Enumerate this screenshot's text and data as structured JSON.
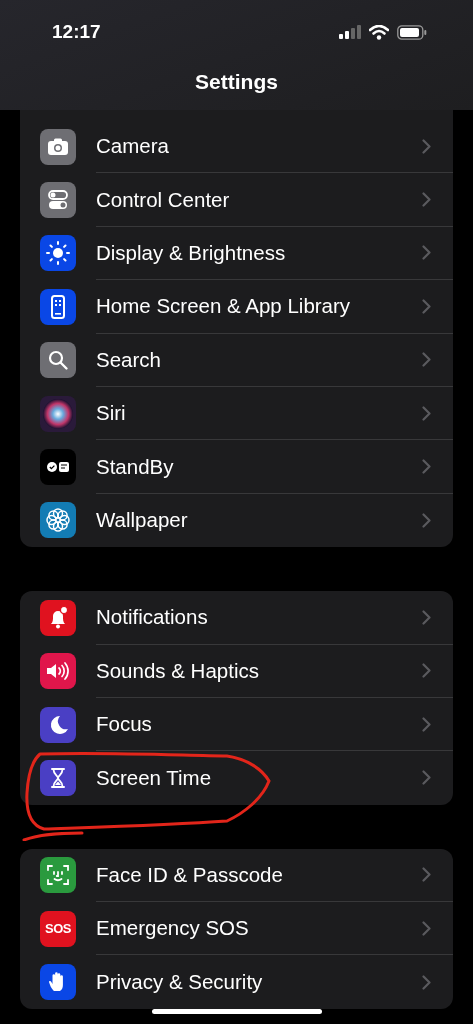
{
  "status_bar": {
    "time": "12:17"
  },
  "title": "Settings",
  "groups": [
    {
      "rows": [
        {
          "label": "Camera",
          "kind": "camera",
          "color": "#6e6e73",
          "circled": false
        },
        {
          "label": "Control Center",
          "kind": "toggles",
          "color": "#6e6e73",
          "circled": false
        },
        {
          "label": "Display & Brightness",
          "kind": "sun",
          "color": "#0a47e6",
          "circled": false
        },
        {
          "label": "Home Screen & App Library",
          "kind": "phone",
          "color": "#0a47e6",
          "circled": false
        },
        {
          "label": "Search",
          "kind": "search",
          "color": "#6e6e73",
          "circled": false
        },
        {
          "label": "Siri",
          "kind": "orb",
          "color": "#2a1a3a",
          "circled": false
        },
        {
          "label": "StandBy",
          "kind": "standby",
          "color": "#000000",
          "circled": false
        },
        {
          "label": "Wallpaper",
          "kind": "flower",
          "color": "#137cb4",
          "circled": false
        }
      ]
    },
    {
      "rows": [
        {
          "label": "Notifications",
          "kind": "bell",
          "color": "#e0121f",
          "circled": false
        },
        {
          "label": "Sounds & Haptics",
          "kind": "speaker",
          "color": "#e0164b",
          "circled": false
        },
        {
          "label": "Focus",
          "kind": "moon",
          "color": "#4a3fc4",
          "circled": false
        },
        {
          "label": "Screen Time",
          "kind": "hourglass",
          "color": "#4a3fc4",
          "circled": true
        }
      ]
    },
    {
      "rows": [
        {
          "label": "Face ID & Passcode",
          "kind": "face",
          "color": "#2a9a3e",
          "circled": false
        },
        {
          "label": "Emergency SOS",
          "kind": "text",
          "icon_text": "SOS",
          "color": "#e0121f",
          "circled": false
        },
        {
          "label": "Privacy & Security",
          "kind": "hand",
          "color": "#0a47e6",
          "circled": false
        }
      ]
    }
  ]
}
